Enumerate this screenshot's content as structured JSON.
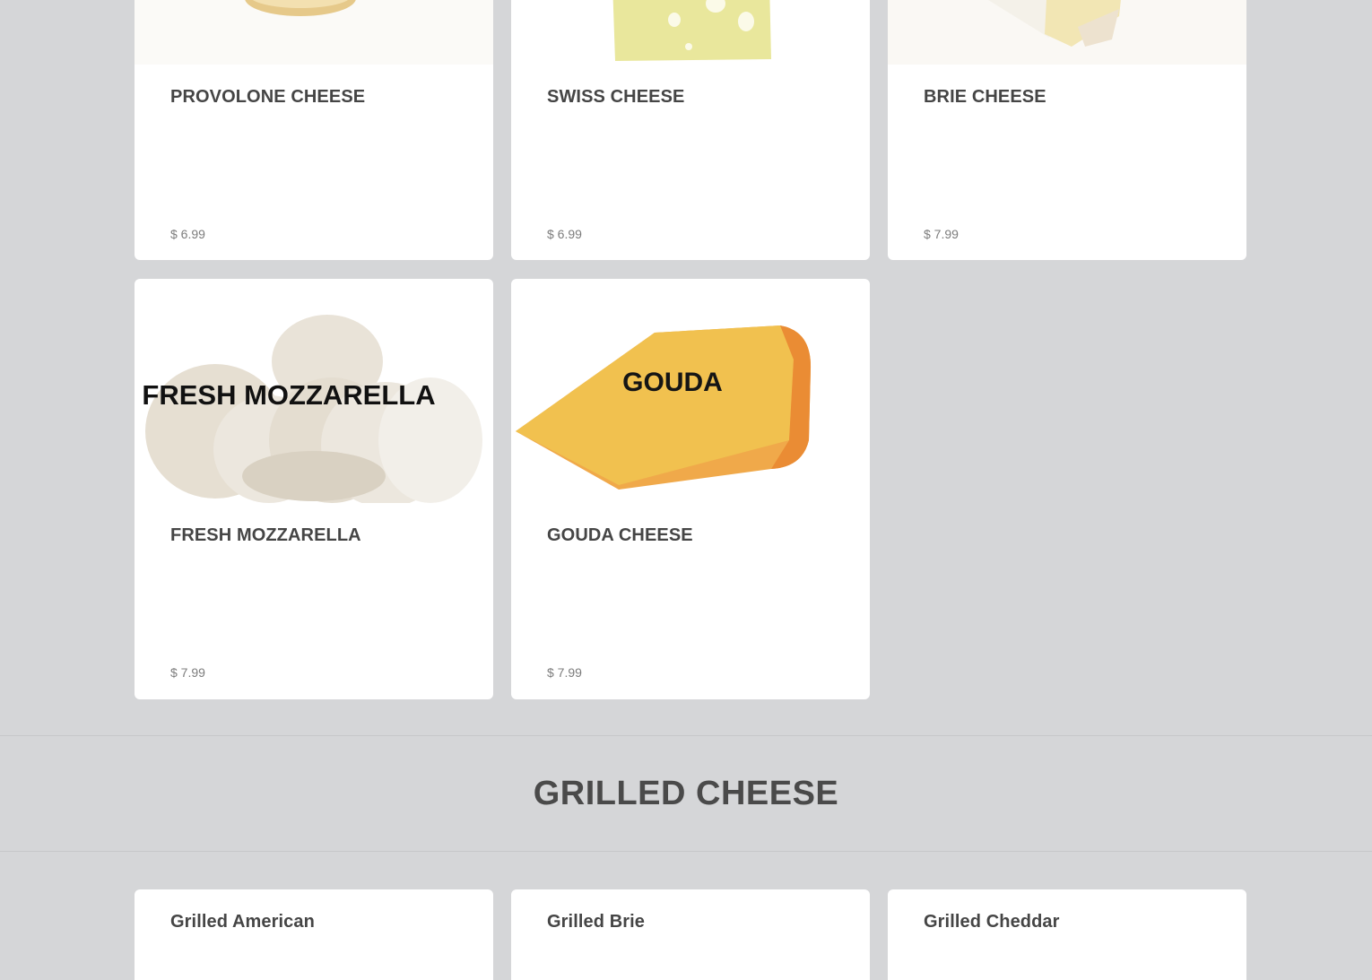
{
  "cheese_items": [
    {
      "name": "PROVOLONE CHEESE",
      "price": "$ 6.99",
      "image_icon": "provolone-image"
    },
    {
      "name": "SWISS CHEESE",
      "price": "$ 6.99",
      "image_icon": "swiss-cheese-image"
    },
    {
      "name": "BRIE CHEESE",
      "price": "$ 7.99",
      "image_icon": "brie-image"
    },
    {
      "name": "FRESH MOZZARELLA",
      "price": "$ 7.99",
      "image_icon": "mozzarella-image",
      "image_text": "FRESH MOZZARELLA"
    },
    {
      "name": "GOUDA CHEESE",
      "price": "$ 7.99",
      "image_icon": "gouda-image",
      "image_text": "GOUDA"
    }
  ],
  "section": {
    "title": "GRILLED CHEESE"
  },
  "grilled_items": [
    {
      "name": "Grilled American"
    },
    {
      "name": "Grilled Brie"
    },
    {
      "name": "Grilled Cheddar"
    }
  ],
  "colors": {
    "background": "#d5d6d8",
    "card": "#ffffff",
    "title_text": "#454545",
    "price_text": "#7c7c7c"
  }
}
